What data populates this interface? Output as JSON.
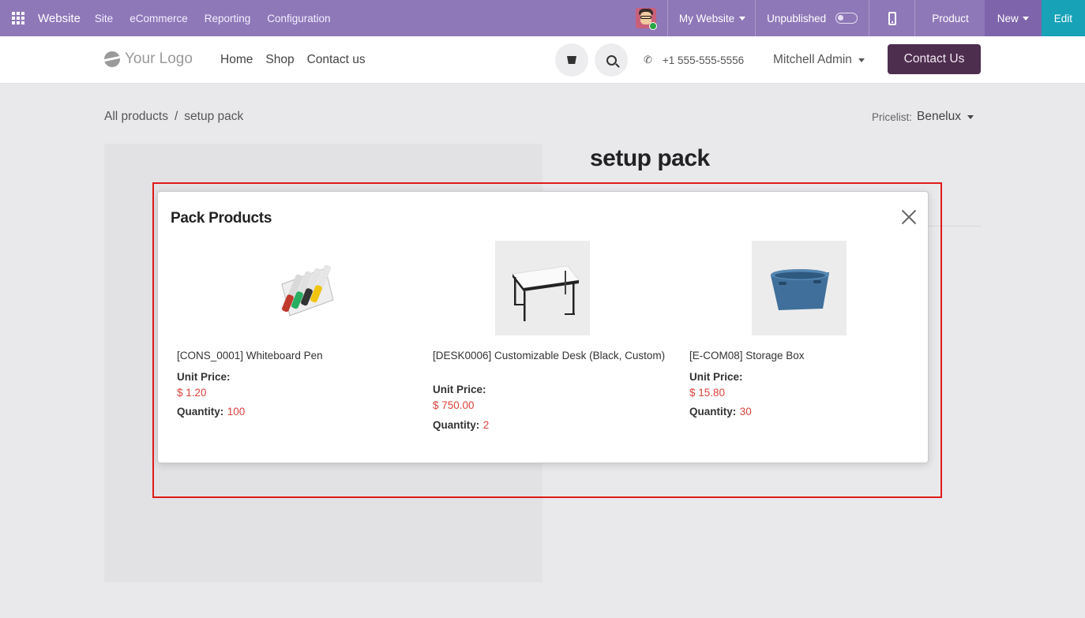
{
  "adminbar": {
    "brand": "Website",
    "menu": [
      "Site",
      "eCommerce",
      "Reporting",
      "Configuration"
    ],
    "my_website": "My Website",
    "unpublished": "Unpublished",
    "product": "Product",
    "new": "New",
    "edit": "Edit",
    "color": "#8f78b8"
  },
  "header": {
    "logo": "Your Logo",
    "nav": [
      "Home",
      "Shop",
      "Contact us"
    ],
    "phone": "+1 555-555-5556",
    "user": "Mitchell Admin",
    "contact_btn": "Contact Us"
  },
  "page": {
    "breadcrumb": {
      "parent": "All products",
      "separator": "/",
      "current": "setup pack"
    },
    "pricelist_label": "Pricelist:",
    "pricelist_value": "Benelux",
    "product_title": "setup pack"
  },
  "modal": {
    "title": "Pack Products",
    "unit_price_label": "Unit Price:",
    "quantity_label": "Quantity:",
    "items": [
      {
        "name": "[CONS_0001] Whiteboard Pen",
        "price": "$ 1.20",
        "quantity": "100",
        "icon": "whiteboard-pens"
      },
      {
        "name": "[DESK0006] Customizable Desk (Black, Custom)",
        "price": "$ 750.00",
        "quantity": "2",
        "icon": "desk"
      },
      {
        "name": "[E-COM08] Storage Box",
        "price": "$ 15.80",
        "quantity": "30",
        "icon": "storage-box"
      }
    ]
  },
  "colors": {
    "accent": "#8f78b8",
    "edit": "#17a2b8",
    "contact": "#4e2e4f",
    "price": "#d9433a",
    "highlight": "#e01b1b"
  }
}
